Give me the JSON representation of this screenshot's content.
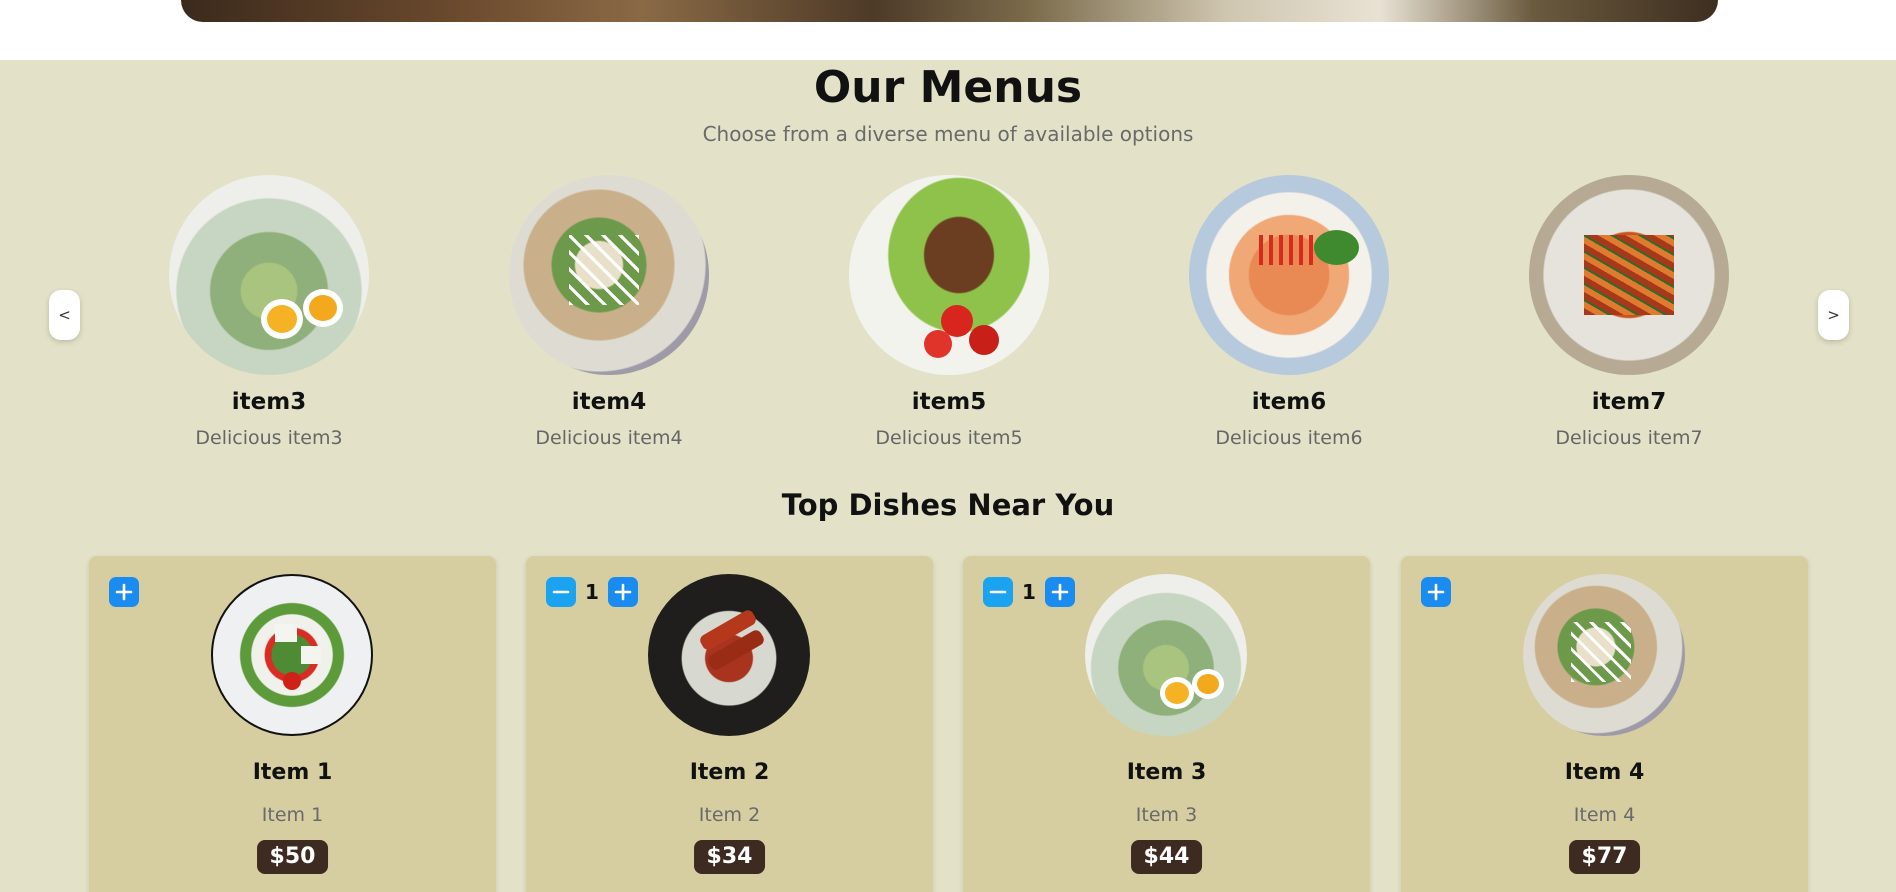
{
  "menus": {
    "title": "Our Menus",
    "subtitle": "Choose from a diverse menu of available options",
    "prev_label": "<",
    "next_label": ">",
    "items": [
      {
        "name": "item3",
        "description": "Delicious item3"
      },
      {
        "name": "item4",
        "description": "Delicious item4"
      },
      {
        "name": "item5",
        "description": "Delicious item5"
      },
      {
        "name": "item6",
        "description": "Delicious item6"
      },
      {
        "name": "item7",
        "description": "Delicious item7"
      }
    ]
  },
  "top_dishes": {
    "title": "Top Dishes Near You",
    "items": [
      {
        "name": "Item 1",
        "description": "Item 1",
        "price": "$50",
        "quantity": ""
      },
      {
        "name": "Item 2",
        "description": "Item 2",
        "price": "$34",
        "quantity": "1"
      },
      {
        "name": "Item 3",
        "description": "Item 3",
        "price": "$44",
        "quantity": "1"
      },
      {
        "name": "Item 4",
        "description": "Item 4",
        "price": "$77",
        "quantity": ""
      }
    ]
  },
  "colors": {
    "section_bg": "#e3e2c8",
    "card_bg": "#d6cea0",
    "price_badge": "#3d2b22",
    "qty_button": "#1a8cf0"
  },
  "icons": {
    "plus": "plus-icon",
    "minus": "minus-icon"
  }
}
